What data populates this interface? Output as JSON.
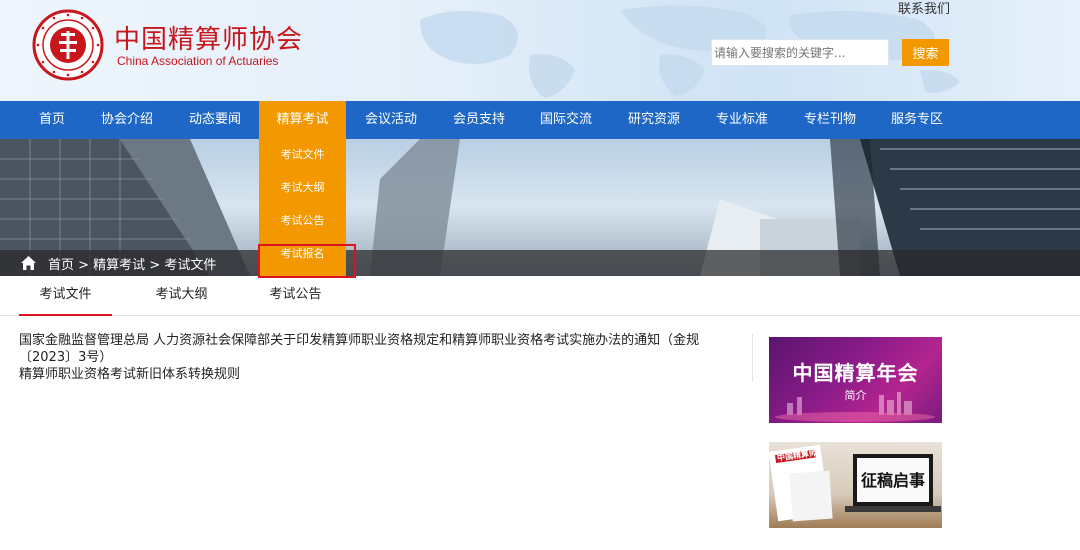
{
  "header": {
    "logo_cn": "中国精算师协会",
    "logo_en": "China Association of Actuaries",
    "contact": "联系我们",
    "search_placeholder": "请输入要搜索的关键字...",
    "search_button": "搜索"
  },
  "nav": {
    "items": [
      "首页",
      "协会介绍",
      "动态要闻",
      "精算考试",
      "会议活动",
      "会员支持",
      "国际交流",
      "研究资源",
      "专业标准",
      "专栏刊物",
      "服务专区"
    ],
    "active": "精算考试"
  },
  "dropdown": {
    "items": [
      "考试文件",
      "考试大纲",
      "考试公告",
      "考试报名"
    ],
    "highlighted": "考试报名"
  },
  "breadcrumb": {
    "text": "首页 > 精算考试 > 考试文件"
  },
  "tabs": {
    "items": [
      "考试文件",
      "考试大纲",
      "考试公告"
    ],
    "active": "考试文件"
  },
  "documents": [
    "国家金融监督管理总局 人力资源社会保障部关于印发精算师职业资格规定和精算师职业资格考试实施办法的通知（金规〔2023〕3号）",
    "精算师职业资格考试新旧体系转换规则"
  ],
  "ads": {
    "ad1_title": "中国精算年会",
    "ad1_sub": "简介",
    "ad2_title": "征稿启事",
    "ad2_magazine": "中国精算师"
  },
  "colors": {
    "brand_red": "#c8161d",
    "nav_blue": "#1f67c7",
    "accent_orange": "#f39800",
    "highlight_red": "#d9161f"
  }
}
